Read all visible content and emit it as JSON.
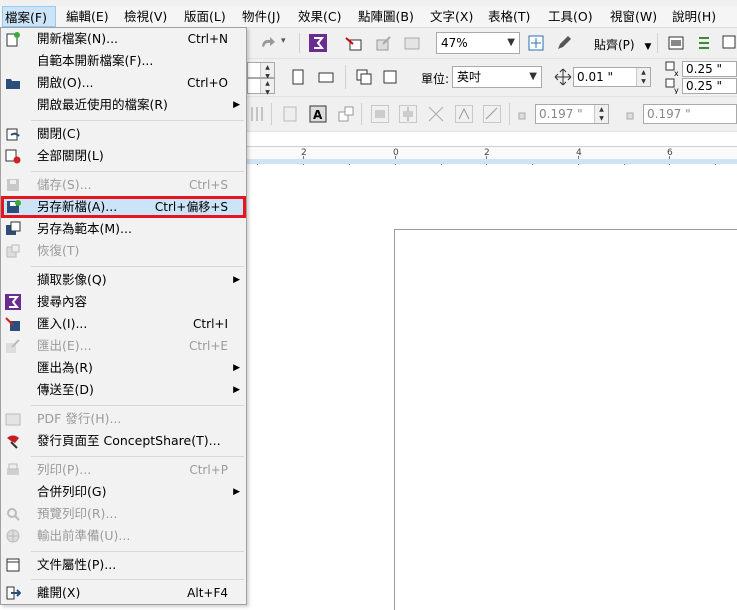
{
  "menubar": {
    "items": [
      {
        "label": "檔案(F)",
        "active": true
      },
      {
        "label": "編輯(E)"
      },
      {
        "label": "檢視(V)"
      },
      {
        "label": "版面(L)"
      },
      {
        "label": "物件(J)"
      },
      {
        "label": "效果(C)"
      },
      {
        "label": "點陣圖(B)"
      },
      {
        "label": "文字(X)"
      },
      {
        "label": "表格(T)"
      },
      {
        "label": "工具(O)"
      },
      {
        "label": "視窗(W)"
      },
      {
        "label": "說明(H)"
      }
    ]
  },
  "toolbar": {
    "zoom": "47%",
    "snap_label": "貼齊(P)",
    "units_label": "單位:",
    "units_value": "英吋",
    "nudge_value": "0.01 \"",
    "dup_x": "0.25 \"",
    "dup_y": "0.25 \"",
    "outline_width_a": "0.197 \"",
    "outline_width_b": "0.197 \""
  },
  "ruler": {
    "labels": [
      "2",
      "0",
      "2",
      "4",
      "6"
    ]
  },
  "file_menu": {
    "items": [
      {
        "label": "開新檔案(N)...",
        "shortcut": "Ctrl+N",
        "icon": "new-file-icon"
      },
      {
        "label": "自範本開新檔案(F)...",
        "shortcut": "",
        "icon": ""
      },
      {
        "label": "開啟(O)...",
        "shortcut": "Ctrl+O",
        "icon": "open-folder-icon"
      },
      {
        "label": "開啟最近使用的檔案(R)",
        "shortcut": "",
        "submenu": true
      },
      {
        "label": "關閉(C)",
        "shortcut": "",
        "icon": "close-doc-icon"
      },
      {
        "label": "全部關閉(L)",
        "shortcut": "",
        "icon": "close-all-icon"
      },
      {
        "label": "儲存(S)...",
        "shortcut": "Ctrl+S",
        "icon": "save-icon",
        "disabled": true
      },
      {
        "label": "另存新檔(A)...",
        "shortcut": "Ctrl+偏移+S",
        "icon": "save-as-icon",
        "highlight": true
      },
      {
        "label": "另存為範本(M)...",
        "shortcut": "",
        "icon": "save-template-icon"
      },
      {
        "label": "恢復(T)",
        "shortcut": "",
        "icon": "revert-icon",
        "disabled": true
      },
      {
        "label": "擷取影像(Q)",
        "shortcut": "",
        "submenu": true
      },
      {
        "label": "搜尋內容",
        "shortcut": "",
        "icon": "search-content-icon"
      },
      {
        "label": "匯入(I)...",
        "shortcut": "Ctrl+I",
        "icon": "import-icon"
      },
      {
        "label": "匯出(E)...",
        "shortcut": "Ctrl+E",
        "icon": "export-icon",
        "disabled": true
      },
      {
        "label": "匯出為(R)",
        "shortcut": "",
        "submenu": true
      },
      {
        "label": "傳送至(D)",
        "shortcut": "",
        "submenu": true
      },
      {
        "label": "PDF 發行(H)...",
        "shortcut": "",
        "icon": "pdf-icon",
        "disabled": true
      },
      {
        "label": "發行頁面至 ConceptShare(T)...",
        "shortcut": "",
        "icon": "conceptshare-icon"
      },
      {
        "label": "列印(P)...",
        "shortcut": "Ctrl+P",
        "icon": "print-icon",
        "disabled": true
      },
      {
        "label": "合併列印(G)",
        "shortcut": "",
        "submenu": true
      },
      {
        "label": "預覽列印(R)...",
        "shortcut": "",
        "icon": "print-preview-icon",
        "disabled": true
      },
      {
        "label": "輸出前準備(U)...",
        "shortcut": "",
        "icon": "prepress-icon",
        "disabled": true
      },
      {
        "label": "文件屬性(P)...",
        "shortcut": "",
        "icon": "doc-properties-icon"
      },
      {
        "label": "離開(X)",
        "shortcut": "Alt+F4",
        "icon": "exit-icon"
      }
    ]
  },
  "colors": {
    "highlight_fill": "#cce4f7",
    "highlight_border": "#e8141d",
    "accent_purple": "#6a2d8f"
  }
}
